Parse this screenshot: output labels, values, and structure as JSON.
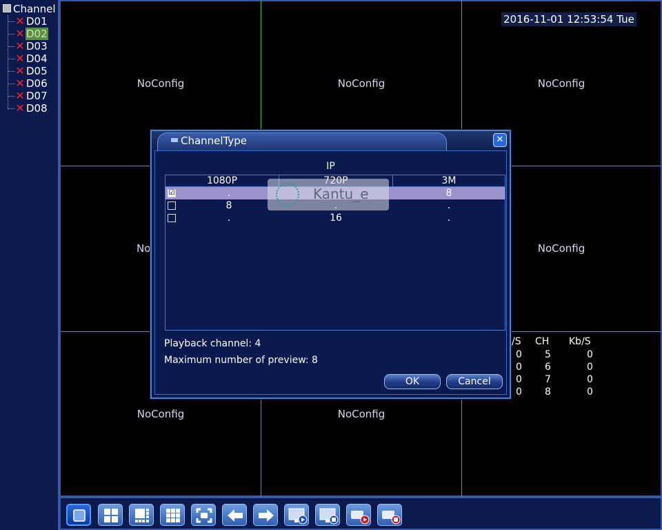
{
  "sidebar": {
    "root_label": "Channel",
    "channels": [
      {
        "label": "D01",
        "status": "disconnected"
      },
      {
        "label": "D02",
        "status": "disconnected",
        "selected": true
      },
      {
        "label": "D03",
        "status": "disconnected"
      },
      {
        "label": "D04",
        "status": "disconnected"
      },
      {
        "label": "D05",
        "status": "disconnected"
      },
      {
        "label": "D06",
        "status": "disconnected"
      },
      {
        "label": "D07",
        "status": "disconnected"
      },
      {
        "label": "D08",
        "status": "disconnected"
      }
    ]
  },
  "overlay": {
    "datetime": "2016-11-01 12:53:54 Tue"
  },
  "grid": {
    "cells": [
      {
        "label": "NoConfig"
      },
      {
        "label": "NoConfig"
      },
      {
        "label": "NoConfig"
      },
      {
        "label": "No"
      },
      {
        "label": ""
      },
      {
        "label": "NoConfig"
      },
      {
        "label": "NoConfig"
      },
      {
        "label": "NoConfig"
      },
      {
        "label": ""
      }
    ]
  },
  "stats": {
    "headers": [
      "/S",
      "CH",
      "Kb/S"
    ],
    "rows": [
      [
        "0",
        "5",
        "0"
      ],
      [
        "0",
        "6",
        "0"
      ],
      [
        "0",
        "7",
        "0"
      ],
      [
        "0",
        "8",
        "0"
      ]
    ]
  },
  "dialog": {
    "title": "ChannelType",
    "close_glyph": "✕",
    "group_label": "IP",
    "columns": [
      "1080P",
      "720P",
      "3M"
    ],
    "rows": [
      {
        "checked": true,
        "mark": "☑",
        "cells": [
          ".",
          ".",
          "8"
        ]
      },
      {
        "checked": false,
        "mark": "",
        "cells": [
          "8",
          ".",
          "."
        ]
      },
      {
        "checked": false,
        "mark": "",
        "cells": [
          ".",
          "16",
          "."
        ]
      }
    ],
    "playback_channel": "Playback channel: 4",
    "max_preview": "Maximum number of preview: 8",
    "ok_label": "OK",
    "cancel_label": "Cancel"
  },
  "watermark": {
    "text": "Kantu_e"
  },
  "toolbar": {
    "buttons": [
      {
        "icon": "single-view-icon",
        "active": true
      },
      {
        "icon": "quad-view-icon"
      },
      {
        "icon": "eight-view-icon"
      },
      {
        "icon": "nine-view-icon"
      },
      {
        "icon": "fullscreen-icon"
      },
      {
        "icon": "previous-arrow-icon"
      },
      {
        "icon": "next-arrow-icon"
      },
      {
        "icon": "playback-icon"
      },
      {
        "icon": "stop-preview-icon"
      },
      {
        "icon": "record-icon"
      },
      {
        "icon": "stop-record-icon"
      }
    ]
  },
  "colors": {
    "background": "#000000",
    "panel": "#0d1a4e",
    "border": "#3a5aa8",
    "selected_row": "#9c92cc",
    "error_x": "#ff2020",
    "highlight_green": "#5a8e4a"
  }
}
